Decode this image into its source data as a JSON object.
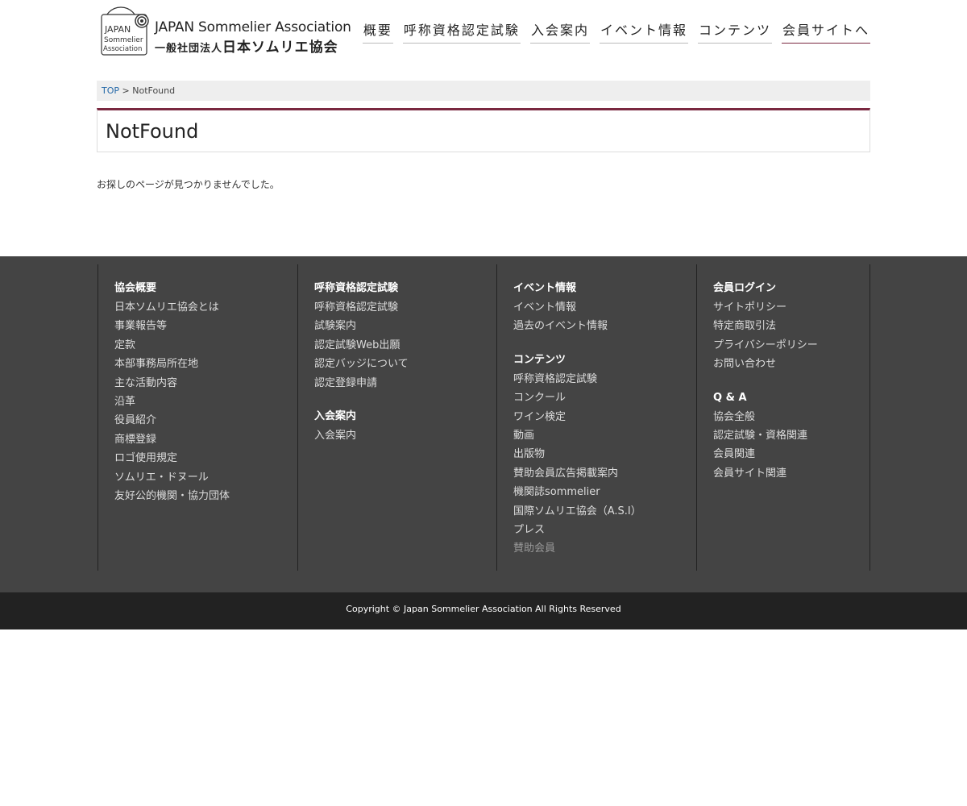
{
  "header": {
    "logo": {
      "mark_line1": "JAPAN",
      "mark_line2": "Sommelier",
      "mark_line3": "Association",
      "en_name": "JAPAN Sommelier Association",
      "jp_prefix": "一般社団法人",
      "jp_name": "日本ソムリエ協会"
    },
    "nav": [
      {
        "label": "概要"
      },
      {
        "label": "呼称資格認定試験"
      },
      {
        "label": "入会案内"
      },
      {
        "label": "イベント情報"
      },
      {
        "label": "コンテンツ"
      },
      {
        "label": "会員サイトへ"
      }
    ],
    "accent_color": "#7a2840"
  },
  "breadcrumb": {
    "home": "TOP",
    "separator": " > ",
    "current": "NotFound"
  },
  "page": {
    "title": "NotFound",
    "message": "お探しのページが見つかりませんでした。"
  },
  "footer": {
    "col1": {
      "heading": "協会概要",
      "links": [
        "日本ソムリエ協会とは",
        "事業報告等",
        "定款",
        "本部事務局所在地",
        "主な活動内容",
        "沿革",
        "役員紹介",
        "商標登録",
        "ロゴ使用規定",
        "ソムリエ・ドヌール",
        "友好公的機関・協力団体"
      ]
    },
    "col2": {
      "heading": "呼称資格認定試験",
      "links": [
        "呼称資格認定試験",
        "試験案内",
        "認定試験Web出願",
        "認定バッジについて",
        "認定登録申請"
      ],
      "heading2": "入会案内",
      "links2": [
        "入会案内"
      ]
    },
    "col3": {
      "heading": "イベント情報",
      "links": [
        "イベント情報",
        "過去のイベント情報"
      ],
      "heading2": "コンテンツ",
      "links2": [
        "呼称資格認定試験",
        "コンクール",
        "ワイン検定",
        "動画",
        "出版物",
        "賛助会員広告掲載案内",
        "機関誌sommelier",
        "国際ソムリエ協会（A.S.I）",
        "プレス",
        "賛助会員"
      ]
    },
    "col4": {
      "heading": "会員ログイン",
      "links": [
        "サイトポリシー",
        "特定商取引法",
        "プライバシーポリシー",
        "お問い合わせ"
      ],
      "heading2": "Q & A",
      "links2": [
        "協会全般",
        "認定試験・資格関連",
        "会員関連",
        "会員サイト関連"
      ]
    },
    "copyright": "Copyright © Japan Sommelier Association All Rights Reserved"
  }
}
